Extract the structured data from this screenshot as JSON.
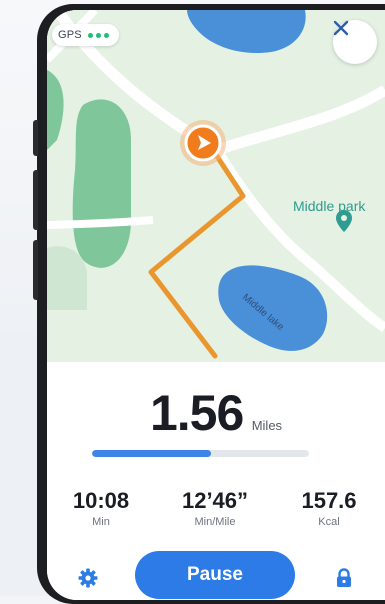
{
  "gps": {
    "label": "GPS",
    "signal_color": "#1fbf73"
  },
  "map": {
    "place_label": "Middle park",
    "lake_label": "Middle lake",
    "route_color": "#e9962f",
    "marker_color": "#f07c1e",
    "water_color": "#4a90d9",
    "park_color": "#7fc79b",
    "icons": [
      "navigation-arrow-icon",
      "location-pin-icon",
      "close-icon"
    ]
  },
  "stats": {
    "distance": {
      "value": "1.56",
      "unit": "Miles"
    },
    "progress": 0.55,
    "time": {
      "value": "10:08",
      "label": "Min"
    },
    "pace": {
      "value": "12’46”",
      "label": "Min/Mile"
    },
    "calories": {
      "value": "157.6",
      "label": "Kcal"
    }
  },
  "controls": {
    "pause_label": "Pause",
    "settings_icon": "gear-icon",
    "lock_icon": "lock-icon",
    "accent_color": "#2d7be6"
  }
}
